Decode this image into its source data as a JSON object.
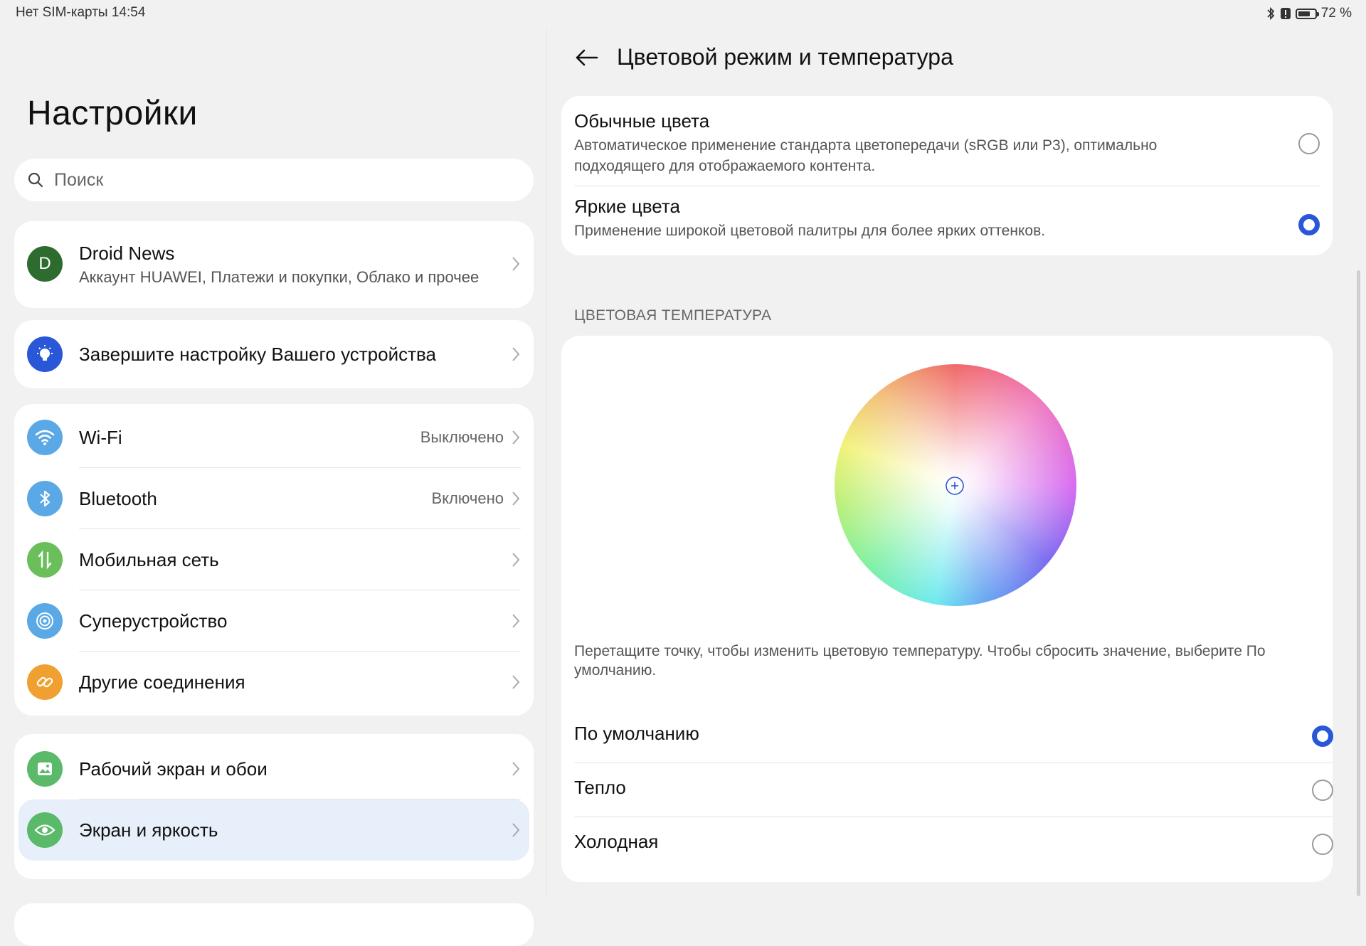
{
  "status_bar": {
    "carrier": "Нет SIM-карты",
    "time": "14:54",
    "battery_percent_label": "72 %",
    "battery_level": 0.72
  },
  "left": {
    "title": "Настройки",
    "search": {
      "placeholder": "Поиск"
    },
    "account": {
      "avatar_letter": "D",
      "name": "Droid News",
      "subtitle": "Аккаунт HUAWEI, Платежи и покупки, Облако и прочее"
    },
    "setup": {
      "label": "Завершите настройку Вашего устройства"
    },
    "connections": [
      {
        "label": "Wi-Fi",
        "value": "Выключено",
        "icon": "wifi-icon",
        "color": "#5aa9e6"
      },
      {
        "label": "Bluetooth",
        "value": "Включено",
        "icon": "bluetooth-icon",
        "color": "#5aa9e6"
      },
      {
        "label": "Мобильная сеть",
        "value": "",
        "icon": "mobile-network-icon",
        "color": "#6abf5a"
      },
      {
        "label": "Суперустройство",
        "value": "",
        "icon": "super-device-icon",
        "color": "#5aa9e6"
      },
      {
        "label": "Другие соединения",
        "value": "",
        "icon": "link-icon",
        "color": "#f0a030"
      }
    ],
    "display": [
      {
        "label": "Рабочий экран и обои",
        "icon": "wallpaper-icon",
        "color": "#5aba6a"
      },
      {
        "label": "Экран и яркость",
        "icon": "eye-icon",
        "color": "#5aba6a",
        "selected": true
      }
    ]
  },
  "right": {
    "title": "Цветовой режим и температура",
    "color_modes": [
      {
        "title": "Обычные цвета",
        "description": "Автоматическое применение стандарта цветопередачи (sRGB или P3), оптимально подходящего для отображаемого контента.",
        "selected": false
      },
      {
        "title": "Яркие цвета",
        "description": "Применение широкой цветовой палитры для более ярких оттенков.",
        "selected": true
      }
    ],
    "section_temperature": "ЦВЕТОВАЯ ТЕМПЕРАТУРА",
    "hint": "Перетащите точку, чтобы изменить цветовую температуру. Чтобы сбросить значение, выберите По умолчанию.",
    "temperature_options": [
      {
        "label": "По умолчанию",
        "selected": true
      },
      {
        "label": "Тепло",
        "selected": false
      },
      {
        "label": "Холодная",
        "selected": false
      }
    ]
  },
  "colors": {
    "accent": "#2a56d8",
    "highlight_bg": "#e6effa"
  }
}
